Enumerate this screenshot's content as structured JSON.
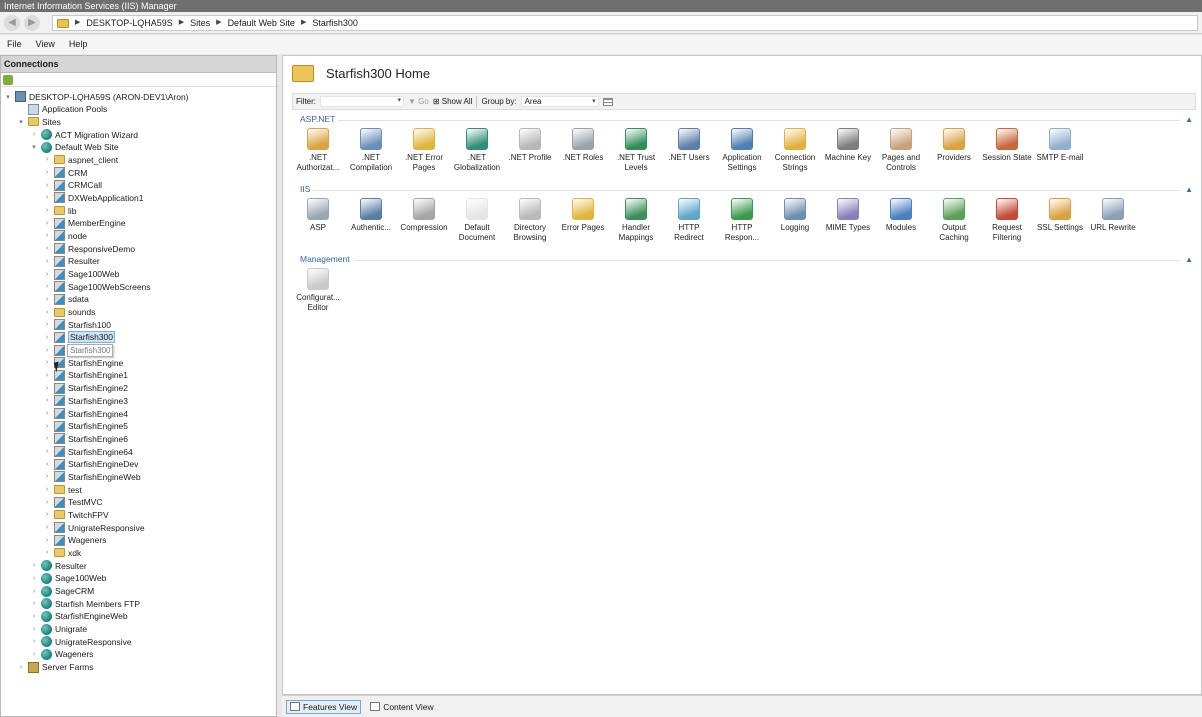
{
  "window": {
    "title": "Internet Information Services (IIS) Manager"
  },
  "address": {
    "segments": [
      "DESKTOP-LQHA59S",
      "Sites",
      "Default Web Site",
      "Starfish300"
    ]
  },
  "menu": [
    "File",
    "View",
    "Help"
  ],
  "connections": {
    "header": "Connections",
    "tooltip": "Starfish300",
    "tree": [
      {
        "label": "DESKTOP-LQHA59S (ARON-DEV1\\Aron)",
        "icon": "server-icon",
        "level": 0,
        "exp": "▾"
      },
      {
        "label": "Application Pools",
        "icon": "app-pool-icon",
        "level": 1,
        "exp": ""
      },
      {
        "label": "Sites",
        "icon": "sites-folder-icon",
        "level": 1,
        "exp": "▾"
      },
      {
        "label": "ACT Migration Wizard",
        "icon": "globe-icon",
        "level": 2,
        "exp": "›"
      },
      {
        "label": "Default Web Site",
        "icon": "globe-icon",
        "level": 2,
        "exp": "▾"
      },
      {
        "label": "aspnet_client",
        "icon": "folder-icon",
        "level": 3,
        "exp": "›"
      },
      {
        "label": "CRM",
        "icon": "app-icon",
        "level": 3,
        "exp": "›"
      },
      {
        "label": "CRMCall",
        "icon": "app-icon",
        "level": 3,
        "exp": "›"
      },
      {
        "label": "DXWebApplication1",
        "icon": "app-icon",
        "level": 3,
        "exp": "›"
      },
      {
        "label": "lib",
        "icon": "folder-icon",
        "level": 3,
        "exp": "›"
      },
      {
        "label": "MemberEngine",
        "icon": "app-icon",
        "level": 3,
        "exp": "›"
      },
      {
        "label": "node",
        "icon": "app-icon",
        "level": 3,
        "exp": "›"
      },
      {
        "label": "ResponsiveDemo",
        "icon": "app-icon",
        "level": 3,
        "exp": "›"
      },
      {
        "label": "Resulter",
        "icon": "app-icon",
        "level": 3,
        "exp": "›"
      },
      {
        "label": "Sage100Web",
        "icon": "app-icon",
        "level": 3,
        "exp": "›"
      },
      {
        "label": "Sage100WebScreens",
        "icon": "app-icon",
        "level": 3,
        "exp": "›"
      },
      {
        "label": "sdata",
        "icon": "app-icon",
        "level": 3,
        "exp": "›"
      },
      {
        "label": "sounds",
        "icon": "folder-icon",
        "level": 3,
        "exp": "›"
      },
      {
        "label": "Starfish100",
        "icon": "app-icon",
        "level": 3,
        "exp": "›"
      },
      {
        "label": "Starfish300",
        "icon": "app-icon",
        "level": 3,
        "exp": "›",
        "selected": true
      },
      {
        "label": "",
        "icon": "app-icon",
        "level": 3,
        "exp": "›"
      },
      {
        "label": "StarfishEngine",
        "icon": "app-icon",
        "level": 3,
        "exp": "›"
      },
      {
        "label": "StarfishEngine1",
        "icon": "app-icon",
        "level": 3,
        "exp": "›"
      },
      {
        "label": "StarfishEngine2",
        "icon": "app-icon",
        "level": 3,
        "exp": "›"
      },
      {
        "label": "StarfishEngine3",
        "icon": "app-icon",
        "level": 3,
        "exp": "›"
      },
      {
        "label": "StarfishEngine4",
        "icon": "app-icon",
        "level": 3,
        "exp": "›"
      },
      {
        "label": "StarfishEngine5",
        "icon": "app-icon",
        "level": 3,
        "exp": "›"
      },
      {
        "label": "StarfishEngine6",
        "icon": "app-icon",
        "level": 3,
        "exp": "›"
      },
      {
        "label": "StarfishEngine64",
        "icon": "app-icon",
        "level": 3,
        "exp": "›"
      },
      {
        "label": "StarfishEngineDev",
        "icon": "app-icon",
        "level": 3,
        "exp": "›"
      },
      {
        "label": "StarfishEngineWeb",
        "icon": "app-icon",
        "level": 3,
        "exp": "›"
      },
      {
        "label": "test",
        "icon": "folder-icon",
        "level": 3,
        "exp": "›"
      },
      {
        "label": "TestMVC",
        "icon": "app-icon",
        "level": 3,
        "exp": "›"
      },
      {
        "label": "TwitchFPV",
        "icon": "folder-icon",
        "level": 3,
        "exp": "›"
      },
      {
        "label": "UnigrateResponsive",
        "icon": "app-icon",
        "level": 3,
        "exp": "›"
      },
      {
        "label": "Wageners",
        "icon": "app-icon",
        "level": 3,
        "exp": "›"
      },
      {
        "label": "xdk",
        "icon": "folder-icon",
        "level": 3,
        "exp": "›"
      },
      {
        "label": "Resulter",
        "icon": "globe-icon",
        "level": 2,
        "exp": "›"
      },
      {
        "label": "Sage100Web",
        "icon": "globe-icon",
        "level": 2,
        "exp": "›"
      },
      {
        "label": "SageCRM",
        "icon": "globe-icon",
        "level": 2,
        "exp": "›"
      },
      {
        "label": "Starfish Members FTP",
        "icon": "globe-icon",
        "level": 2,
        "exp": "›"
      },
      {
        "label": "StarfishEngineWeb",
        "icon": "globe-icon",
        "level": 2,
        "exp": "›"
      },
      {
        "label": "Unigrate",
        "icon": "globe-icon",
        "level": 2,
        "exp": "›"
      },
      {
        "label": "UnigrateResponsive",
        "icon": "globe-icon",
        "level": 2,
        "exp": "›"
      },
      {
        "label": "Wageners",
        "icon": "globe-icon",
        "level": 2,
        "exp": "›"
      },
      {
        "label": "Server Farms",
        "icon": "server-farm-icon",
        "level": 1,
        "exp": "›"
      }
    ]
  },
  "page": {
    "title": "Starfish300 Home"
  },
  "filterbar": {
    "filter_label": "Filter:",
    "go_label": "Go",
    "show_all_label": "Show All",
    "group_by_label": "Group by:",
    "group_by_value": "Area"
  },
  "groups": [
    {
      "name": "ASP.NET",
      "features": [
        {
          "label": ".NET Authorizat...",
          "icon": "net-authorization-icon",
          "color": "#d9a441"
        },
        {
          "label": ".NET Compilation",
          "icon": "net-compilation-icon",
          "color": "#6a8fb8"
        },
        {
          "label": ".NET Error Pages",
          "icon": "net-error-pages-icon",
          "color": "#e0b53a"
        },
        {
          "label": ".NET Globalization",
          "icon": "net-globalization-icon",
          "color": "#2f8f7a"
        },
        {
          "label": ".NET Profile",
          "icon": "net-profile-icon",
          "color": "#b7b7b7"
        },
        {
          "label": ".NET Roles",
          "icon": "net-roles-icon",
          "color": "#9aa3ad"
        },
        {
          "label": ".NET Trust Levels",
          "icon": "net-trust-levels-icon",
          "color": "#2f8f5a"
        },
        {
          "label": ".NET Users",
          "icon": "net-users-icon",
          "color": "#5b7fa6"
        },
        {
          "label": "Application Settings",
          "icon": "application-settings-icon",
          "color": "#4e7fb0"
        },
        {
          "label": "Connection Strings",
          "icon": "connection-strings-icon",
          "color": "#e2b13c"
        },
        {
          "label": "Machine Key",
          "icon": "machine-key-icon",
          "color": "#7d7d7d"
        },
        {
          "label": "Pages and Controls",
          "icon": "pages-controls-icon",
          "color": "#c9a27a"
        },
        {
          "label": "Providers",
          "icon": "providers-icon",
          "color": "#d8a23f"
        },
        {
          "label": "Session State",
          "icon": "session-state-icon",
          "color": "#c9683a"
        },
        {
          "label": "SMTP E-mail",
          "icon": "smtp-email-icon",
          "color": "#8fb0cf"
        }
      ]
    },
    {
      "name": "IIS",
      "features": [
        {
          "label": "ASP",
          "icon": "asp-icon",
          "color": "#9aa7b3"
        },
        {
          "label": "Authentic...",
          "icon": "authentication-icon",
          "color": "#5b7fa6"
        },
        {
          "label": "Compression",
          "icon": "compression-icon",
          "color": "#a5a5a5"
        },
        {
          "label": "Default Document",
          "icon": "default-document-icon",
          "color": "#e5e5e5"
        },
        {
          "label": "Directory Browsing",
          "icon": "directory-browsing-icon",
          "color": "#b9b9b9"
        },
        {
          "label": "Error Pages",
          "icon": "error-pages-icon",
          "color": "#e0b53a"
        },
        {
          "label": "Handler Mappings",
          "icon": "handler-mappings-icon",
          "color": "#3c8f5a"
        },
        {
          "label": "HTTP Redirect",
          "icon": "http-redirect-icon",
          "color": "#5fa6c9"
        },
        {
          "label": "HTTP Respon...",
          "icon": "http-response-headers-icon",
          "color": "#3c9a4e"
        },
        {
          "label": "Logging",
          "icon": "logging-icon",
          "color": "#6f8fb0"
        },
        {
          "label": "MIME Types",
          "icon": "mime-types-icon",
          "color": "#8a7fb8"
        },
        {
          "label": "Modules",
          "icon": "modules-icon",
          "color": "#4a7fc0"
        },
        {
          "label": "Output Caching",
          "icon": "output-caching-icon",
          "color": "#5ba05a"
        },
        {
          "label": "Request Filtering",
          "icon": "request-filtering-icon",
          "color": "#c44b3a"
        },
        {
          "label": "SSL Settings",
          "icon": "ssl-settings-icon",
          "color": "#d8a23f"
        },
        {
          "label": "URL Rewrite",
          "icon": "url-rewrite-icon",
          "color": "#8aa0b8"
        }
      ]
    },
    {
      "name": "Management",
      "features": [
        {
          "label": "Configurat... Editor",
          "icon": "configuration-editor-icon",
          "color": "#c9c9c9"
        }
      ]
    }
  ],
  "views": {
    "features_label": "Features View",
    "content_label": "Content View"
  }
}
